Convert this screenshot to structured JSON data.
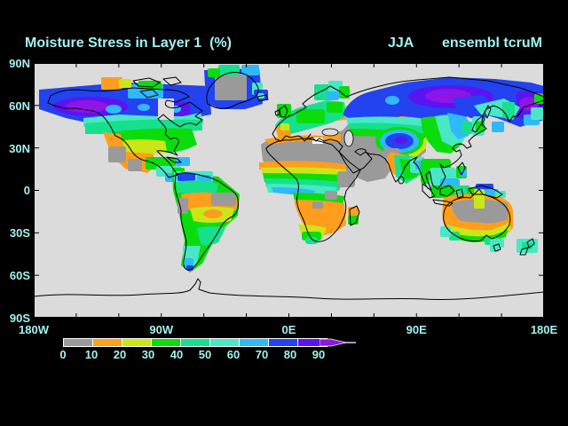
{
  "header": {
    "title": "Moisture Stress in Layer 1  (%)",
    "season": "JJA",
    "run": "ensembl tcruM"
  },
  "map": {
    "lat_labels": [
      "90N",
      "60N",
      "30N",
      "0",
      "30S",
      "60S",
      "90S"
    ],
    "lon_labels": [
      "180W",
      "90W",
      "0E",
      "90E",
      "180E"
    ]
  },
  "colorbar": {
    "labels": [
      "0",
      "10",
      "20",
      "30",
      "40",
      "50",
      "60",
      "70",
      "80",
      "90"
    ],
    "segment_colors": [
      "#9A9A9A",
      "#FF9E1C",
      "#CBE617",
      "#0BDC0B",
      "#16E08E",
      "#48E8C4",
      "#2FB9F8",
      "#2342F0",
      "#5A14F0"
    ],
    "over_arrow_color": "#8F14E6"
  },
  "colors": {
    "background": "#000000",
    "ocean": "#DBDBDB",
    "coastline": "#000000",
    "text": "#A4F1F1",
    "palette": {
      "g": "#9A9A9A",
      "o": "#FF9E1C",
      "y": "#CBE617",
      "gr": "#0BDC0B",
      "sg": "#16E08E",
      "tq": "#48E8C4",
      "sk": "#2FB9F8",
      "bl": "#2342F0",
      "vi": "#5A14F0",
      "pu": "#8F14E6",
      "wh": "#FFFFFF",
      "ocean": "#DBDBDB"
    }
  },
  "chart_data": {
    "type": "heatmap",
    "title": "Moisture Stress in Layer 1 (%)",
    "season": "JJA",
    "experiment": "ensembl tcruM",
    "projection": "equirectangular world map",
    "lon_range": [
      -180,
      180
    ],
    "lat_range": [
      -90,
      90
    ],
    "x_ticks": [
      "180W",
      "90W",
      "0E",
      "90E",
      "180E"
    ],
    "y_ticks": [
      "90N",
      "60N",
      "30N",
      "0",
      "30S",
      "60S",
      "90S"
    ],
    "grid": false,
    "legend_position": "bottom horizontal colorbar with over-range arrow",
    "colorbar_levels": [
      0,
      10,
      20,
      30,
      40,
      50,
      60,
      70,
      80,
      90
    ],
    "colorbar_colors": [
      "#9A9A9A",
      "#FF9E1C",
      "#CBE617",
      "#0BDC0B",
      "#16E08E",
      "#48E8C4",
      "#2FB9F8",
      "#2342F0",
      "#5A14F0"
    ],
    "over_90_color": "#8F14E6",
    "ocean_no_data_color": "#DBDBDB",
    "regions": [
      {
        "region": "Alaska / Yukon / NW Canada",
        "value_pct": "80 to >90"
      },
      {
        "region": "Northern Canada / Labrador",
        "value_pct": "60-80"
      },
      {
        "region": "Canadian Arctic coast patch",
        "value_pct": "10-30"
      },
      {
        "region": "Southern Canada",
        "value_pct": "40-60"
      },
      {
        "region": "Eastern / Midwest US",
        "value_pct": "20-40"
      },
      {
        "region": "California / SW US / NW Mexico",
        "value_pct": "0-20"
      },
      {
        "region": "Greenland interior",
        "value_pct": "0-10"
      },
      {
        "region": "Greenland margins",
        "value_pct": "40-80"
      },
      {
        "region": "Central America / Caribbean",
        "value_pct": "30-60"
      },
      {
        "region": "Northern South America",
        "value_pct": "40-80"
      },
      {
        "region": "Amazon band",
        "value_pct": "10-20"
      },
      {
        "region": "NE Brazil / coastal Peru",
        "value_pct": "0-10"
      },
      {
        "region": "Central Brazil",
        "value_pct": "20-30"
      },
      {
        "region": "Southern Brazil / Argentina",
        "value_pct": "30-50"
      },
      {
        "region": "Patagonia tip",
        "value_pct": "50-80"
      },
      {
        "region": "Sahara / Arabia / Middle East / Central Asia",
        "value_pct": "0-10"
      },
      {
        "region": "Sahel band",
        "value_pct": "10-30"
      },
      {
        "region": "Equatorial West Africa",
        "value_pct": "40-70"
      },
      {
        "region": "Horn of Africa / East Africa spots",
        "value_pct": "0-10"
      },
      {
        "region": "Southern Africa",
        "value_pct": "10-20"
      },
      {
        "region": "South Africa cape",
        "value_pct": "20-40"
      },
      {
        "region": "Europe",
        "value_pct": "30-50"
      },
      {
        "region": "Scandinavia",
        "value_pct": "40-70"
      },
      {
        "region": "Siberia core",
        "value_pct": "80 to >90"
      },
      {
        "region": "Siberia broad",
        "value_pct": "70-80"
      },
      {
        "region": "NE China",
        "value_pct": "60-80"
      },
      {
        "region": "Tibetan Plateau",
        "value_pct": "60-90"
      },
      {
        "region": "NW India / Pakistan",
        "value_pct": "0-20"
      },
      {
        "region": "India / SE Asia",
        "value_pct": "30-70"
      },
      {
        "region": "Indonesia / New Guinea",
        "value_pct": "30-80"
      },
      {
        "region": "Australia interior",
        "value_pct": "0-10"
      },
      {
        "region": "Australia rim",
        "value_pct": "10-40"
      },
      {
        "region": "SE Australia / Tasmania / New Zealand",
        "value_pct": "40-60"
      }
    ]
  }
}
